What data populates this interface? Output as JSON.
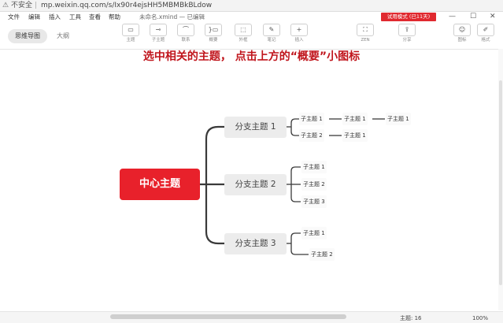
{
  "browser": {
    "warning_icon": "warning-triangle-icon",
    "insecure_label": "不安全",
    "url": "mp.weixin.qq.com/s/Ix90r4ejsHH5MBMBkBLdow"
  },
  "menu": {
    "items": [
      "文件",
      "编辑",
      "插入",
      "工具",
      "查看",
      "帮助"
    ],
    "doc_title": "未命名.xmind — 已编辑",
    "trial_badge": "试用模式 (已11天)",
    "window_controls": [
      "—",
      "☐",
      "✕"
    ]
  },
  "toolbar": {
    "view_tabs": [
      "思维导图",
      "大纲"
    ],
    "tools": [
      {
        "label": "主题",
        "icon": "topic-icon",
        "glyph": "▭"
      },
      {
        "label": "子主题",
        "icon": "subtopic-icon",
        "glyph": "⊸"
      },
      {
        "label": "联系",
        "icon": "relationship-icon",
        "glyph": "⌒"
      },
      {
        "label": "概要",
        "icon": "summary-icon",
        "glyph": "}▭"
      },
      {
        "label": "外框",
        "icon": "boundary-icon",
        "glyph": "⬚"
      },
      {
        "label": "笔记",
        "icon": "note-icon",
        "glyph": "✎"
      },
      {
        "label": "插入",
        "icon": "insert-icon",
        "glyph": "+"
      }
    ],
    "zen_label": "ZEN",
    "share_label": "分享",
    "right_tools": [
      {
        "label": "图标",
        "icon": "emoji-icon",
        "glyph": "☺"
      },
      {
        "label": "格式",
        "icon": "format-brush-icon",
        "glyph": "✐"
      }
    ]
  },
  "instruction": "选中相关的主题， 点击上方的“概要”小图标",
  "mindmap": {
    "central": "中心主题",
    "branches": [
      {
        "label": "分支主题 1",
        "subtopics": [
          "子主题 1",
          "子主题 1",
          "子主题 1",
          "子主题 2",
          "子主题 1"
        ]
      },
      {
        "label": "分支主题 2",
        "subtopics": [
          "子主题 1",
          "子主题 2",
          "子主题 3"
        ]
      },
      {
        "label": "分支主题 3",
        "subtopics": [
          "子主题 1",
          "子主题 2"
        ]
      }
    ]
  },
  "status": {
    "topic_count": "主题: 16",
    "zoom": "100%"
  },
  "colors": {
    "central": "#e8212b",
    "instruction": "#c0151c",
    "trial_badge": "#e0292f",
    "branch_fill": "#ececec"
  }
}
